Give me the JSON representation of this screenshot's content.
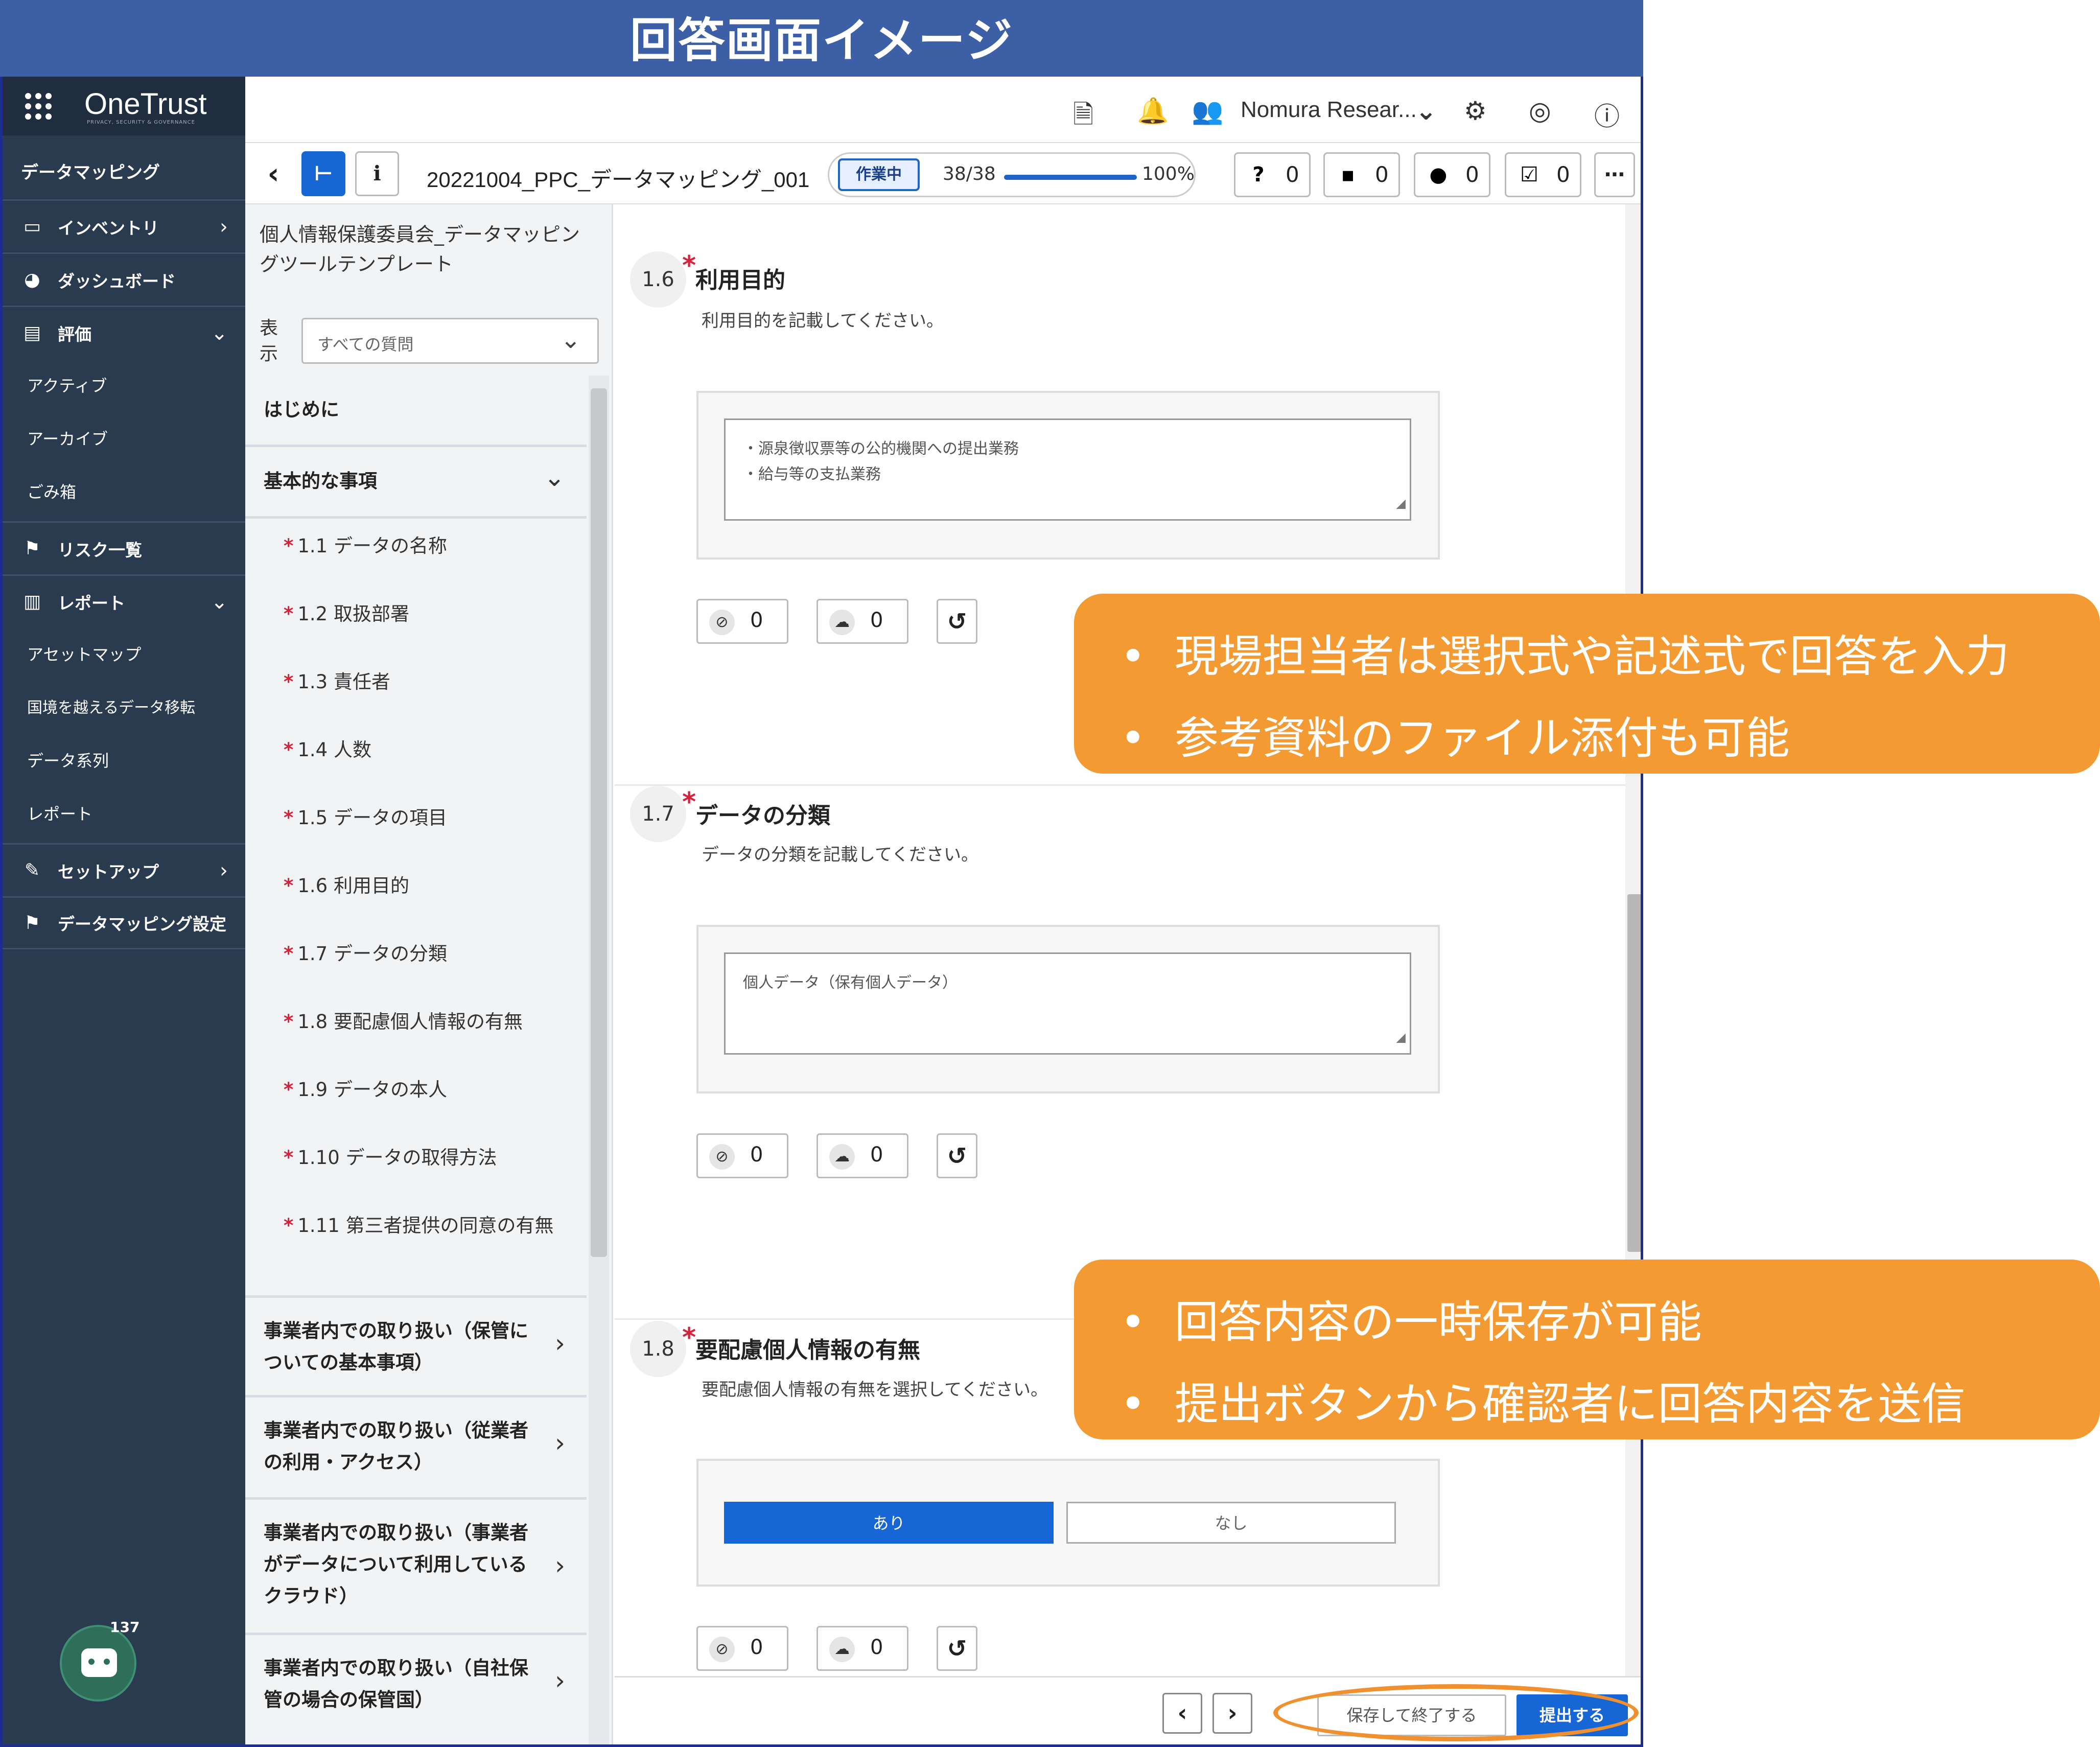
{
  "page_title": "回答画面イメージ",
  "app": {
    "logo": "OneTrust",
    "logo_sub": "PRIVACY, SECURITY & GOVERNANCE",
    "module": "データマッピング"
  },
  "nav": {
    "inventory": "インベントリ",
    "dashboard": "ダッシュボード",
    "assessment": "評価",
    "assessment_items": [
      "アクティブ",
      "アーカイブ",
      "ごみ箱"
    ],
    "risks": "リスク一覧",
    "reports": "レポート",
    "report_items": [
      "アセットマップ",
      "国境を越えるデータ移転",
      "データ系列",
      "レポート"
    ],
    "setup": "セットアップ",
    "dm_settings": "データマッピング設定",
    "bot_badge": "137"
  },
  "topbar": {
    "user": "Nomura Resear..."
  },
  "toolbar": {
    "doc_title": "20221004_PPC_データマッピング_001",
    "status": "作業中",
    "progress_count": "38/38",
    "progress_pct": "100%",
    "progress_fraction": 1.0,
    "counters": [
      "0",
      "0",
      "0",
      "0"
    ]
  },
  "questionnaire": {
    "template_name": "個人情報保護委員会_データマッピングツールテンプレート",
    "filter_label": "表示",
    "filter_value": "すべての質問",
    "sec_intro": "はじめに",
    "sec_basic": "基本的な事項",
    "questions": [
      "1.1 データの名称",
      "1.2 取扱部署",
      "1.3 責任者",
      "1.4 人数",
      "1.5 データの項目",
      "1.6 利用目的",
      "1.7 データの分類",
      "1.8 要配慮個人情報の有無",
      "1.9 データの本人",
      "1.10 データの取得方法",
      "1.11 第三者提供の同意の有無"
    ],
    "req_mark": "*",
    "sections": [
      "事業者内での取り扱い（保管についての基本事項）",
      "事業者内での取り扱い（従業者の利用・アクセス）",
      "事業者内での取り扱い（事業者がデータについて利用しているクラウド）",
      "事業者内での取り扱い（自社保管の場合の保管国）"
    ]
  },
  "main": {
    "q16": {
      "num": "1.6",
      "title": "利用目的",
      "desc": "利用目的を記載してください。",
      "answer": "・源泉徴収票等の公的機関への提出業務\n・給与等の支払業務",
      "attach": "0",
      "comment": "0"
    },
    "q17": {
      "num": "1.7",
      "title": "データの分類",
      "desc": "データの分類を記載してください。",
      "answer": "個人データ（保有個人データ）",
      "attach": "0",
      "comment": "0"
    },
    "q18": {
      "num": "1.8",
      "title": "要配慮個人情報の有無",
      "desc": "要配慮個人情報の有無を選択してください。",
      "option_yes": "あり",
      "option_no": "なし",
      "selected": "あり",
      "attach": "0",
      "comment": "0"
    }
  },
  "footer": {
    "save": "保存して終了する",
    "submit": "提出する"
  },
  "callouts": {
    "top": [
      "現場担当者は選択式や記述式で回答を入力",
      "参考資料のファイル添付も可能"
    ],
    "bottom": [
      "回答内容の一時保存が可能",
      "提出ボタンから確認者に回答内容を送信"
    ]
  },
  "colors": {
    "accent": "#1766d6",
    "nav_bg": "#2a3a4f",
    "callout": "#f39a32",
    "title_bar": "#3d5fa6",
    "required": "#d6213a"
  }
}
